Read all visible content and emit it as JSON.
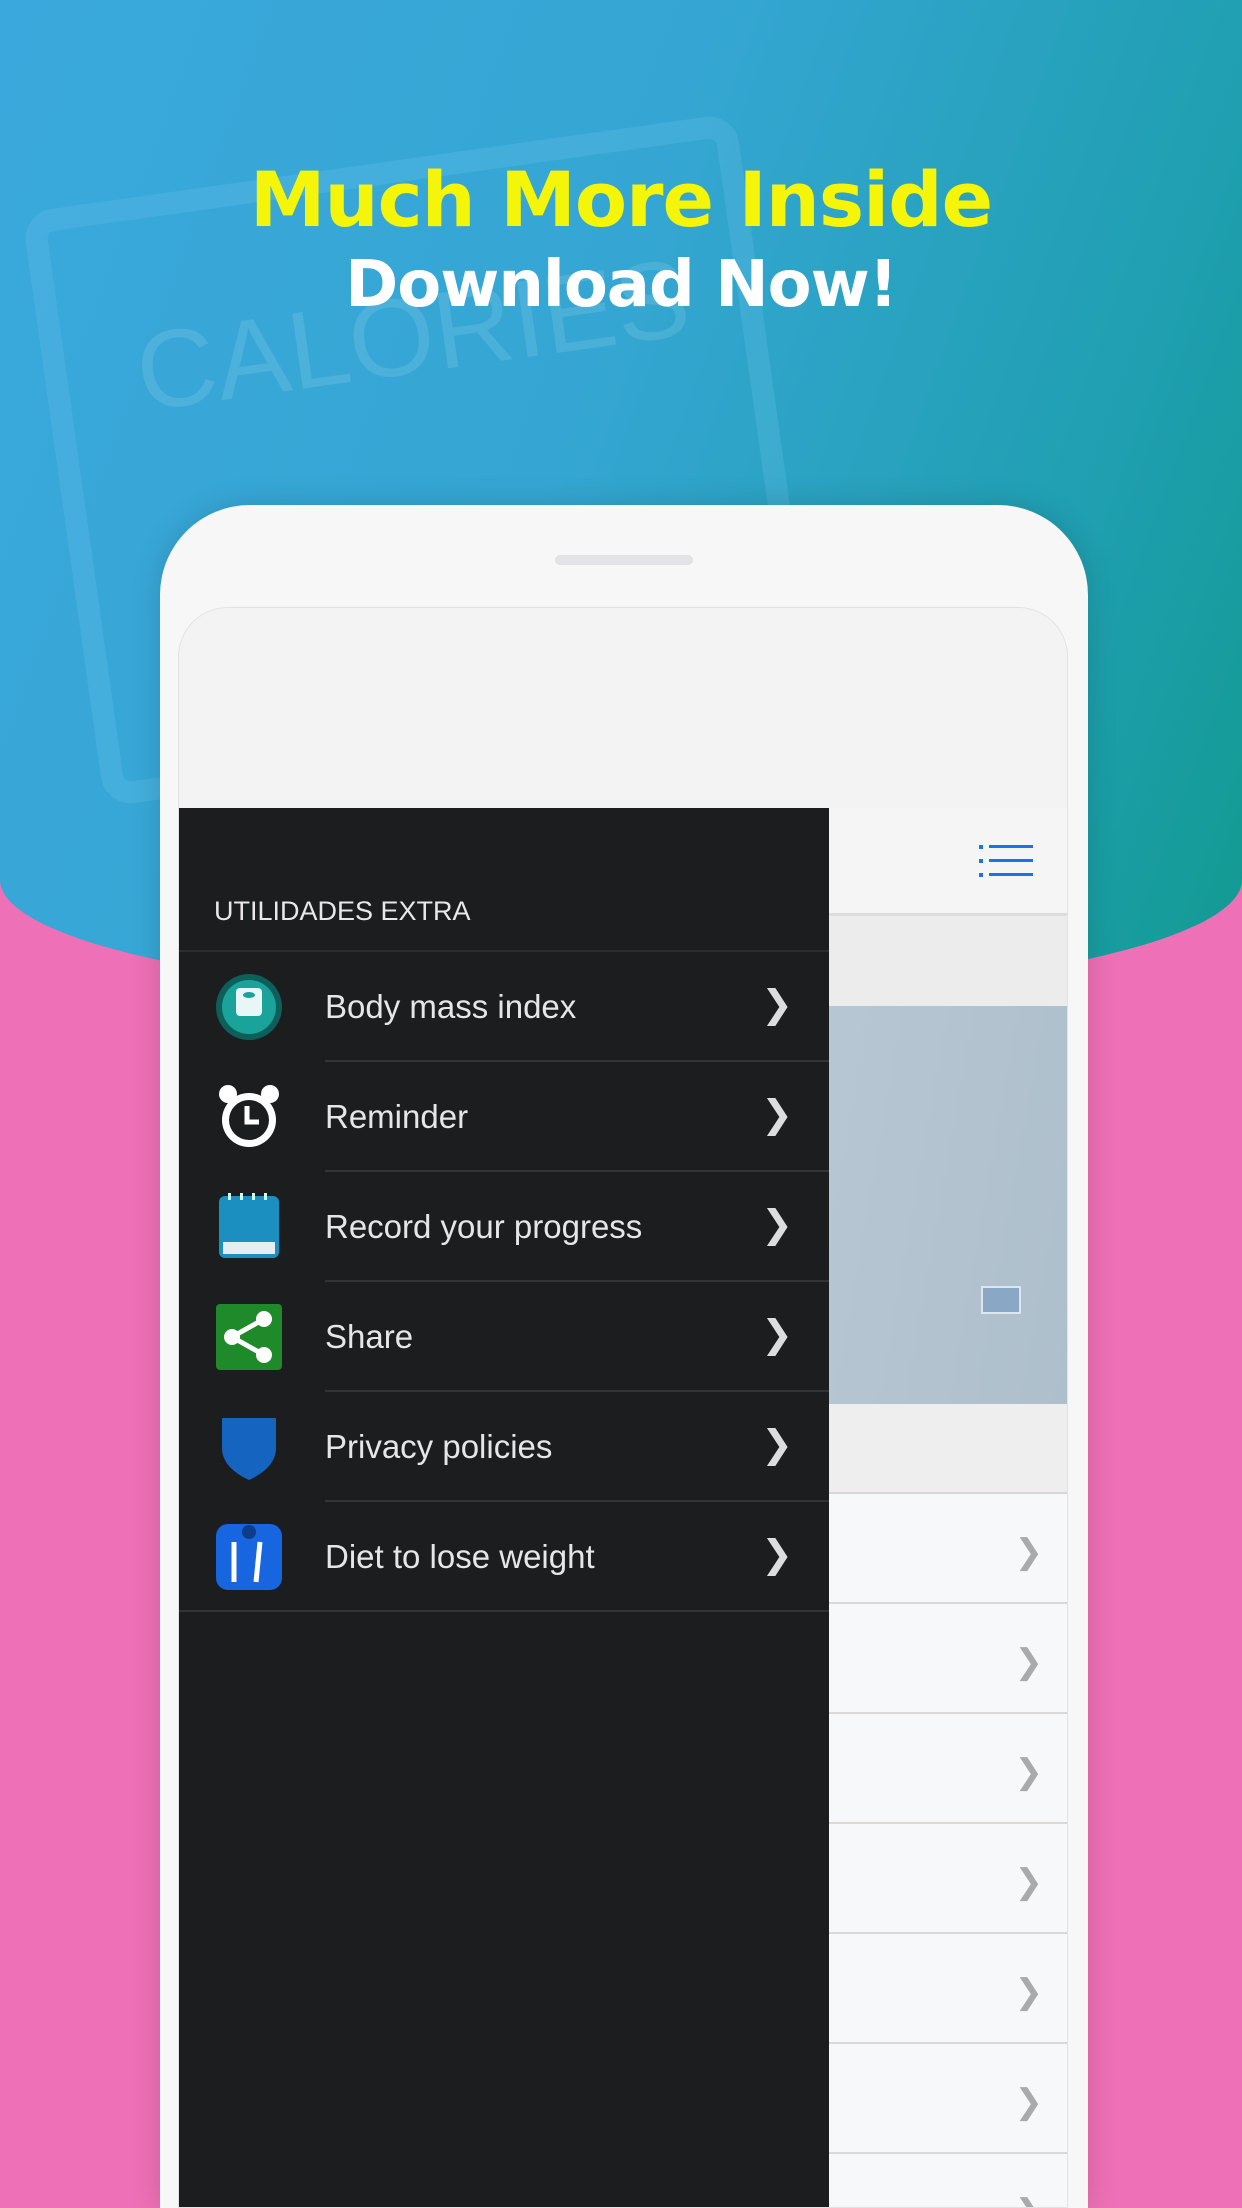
{
  "promo": {
    "headline": "Much More Inside",
    "subheadline": "Download Now!",
    "headline_color": "#f5f50a",
    "accent_pink": "#ee70b6"
  },
  "background": {
    "tablet_text": "CALORIES"
  },
  "drawer": {
    "section_title": "UTILIDADES EXTRA",
    "items": [
      {
        "label": "Body mass index",
        "icon": "bmi-scale-icon"
      },
      {
        "label": "Reminder",
        "icon": "alarm-clock-icon"
      },
      {
        "label": "Record your progress",
        "icon": "notebook-icon"
      },
      {
        "label": "Share",
        "icon": "share-icon"
      },
      {
        "label": "Privacy policies",
        "icon": "shield-icon"
      },
      {
        "label": "Diet to lose weight",
        "icon": "diet-scale-icon"
      }
    ]
  },
  "appbar": {
    "menu_icon": "list-menu-icon",
    "accent": "#1a73e8"
  }
}
